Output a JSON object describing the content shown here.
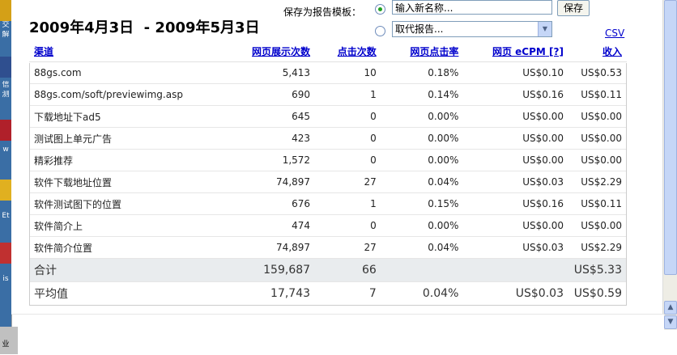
{
  "header": {
    "date_range": "2009年4月3日  - 2009年5月3日",
    "save_label": "保存为报告模板：",
    "name_placeholder": "输入新名称...",
    "save_button": "保存",
    "replace_select": "取代报告...",
    "csv_link": "CSV"
  },
  "columns": {
    "channel": "渠道",
    "impressions": "网页展示次数",
    "clicks": "点击次数",
    "ctr": "网页点击率",
    "ecpm": "网页  eCPM",
    "help": "[?]",
    "revenue": "收入"
  },
  "rows": [
    {
      "channel": "88gs.com",
      "impressions": "5,413",
      "clicks": "10",
      "ctr": "0.18%",
      "ecpm": "US$0.10",
      "revenue": "US$0.53"
    },
    {
      "channel": "88gs.com/soft/previewimg.asp",
      "impressions": "690",
      "clicks": "1",
      "ctr": "0.14%",
      "ecpm": "US$0.16",
      "revenue": "US$0.11"
    },
    {
      "channel": "下载地址下ad5",
      "impressions": "645",
      "clicks": "0",
      "ctr": "0.00%",
      "ecpm": "US$0.00",
      "revenue": "US$0.00"
    },
    {
      "channel": "测试图上单元广告",
      "impressions": "423",
      "clicks": "0",
      "ctr": "0.00%",
      "ecpm": "US$0.00",
      "revenue": "US$0.00"
    },
    {
      "channel": "精彩推荐",
      "impressions": "1,572",
      "clicks": "0",
      "ctr": "0.00%",
      "ecpm": "US$0.00",
      "revenue": "US$0.00"
    },
    {
      "channel": "软件下载地址位置",
      "impressions": "74,897",
      "clicks": "27",
      "ctr": "0.04%",
      "ecpm": "US$0.03",
      "revenue": "US$2.29"
    },
    {
      "channel": "软件测试图下的位置",
      "impressions": "676",
      "clicks": "1",
      "ctr": "0.15%",
      "ecpm": "US$0.16",
      "revenue": "US$0.11"
    },
    {
      "channel": "软件简介上",
      "impressions": "474",
      "clicks": "0",
      "ctr": "0.00%",
      "ecpm": "US$0.00",
      "revenue": "US$0.00"
    },
    {
      "channel": "软件简介位置",
      "impressions": "74,897",
      "clicks": "27",
      "ctr": "0.04%",
      "ecpm": "US$0.03",
      "revenue": "US$2.29"
    }
  ],
  "total": {
    "label": "合计",
    "impressions": "159,687",
    "clicks": "66",
    "ctr": "",
    "ecpm": "",
    "revenue": "US$5.33"
  },
  "average": {
    "label": "平均值",
    "impressions": "17,743",
    "clicks": "7",
    "ctr": "0.04%",
    "ecpm": "US$0.03",
    "revenue": "US$0.59"
  },
  "desktop_labels": [
    "交",
    "解",
    "信",
    "测",
    "w",
    "Et",
    "is",
    "业"
  ],
  "colors": {
    "link": "#0000cc",
    "total_bg": "#e9ecee",
    "desktop": "#3a6ea5",
    "scroll": "#c5d6f7"
  }
}
